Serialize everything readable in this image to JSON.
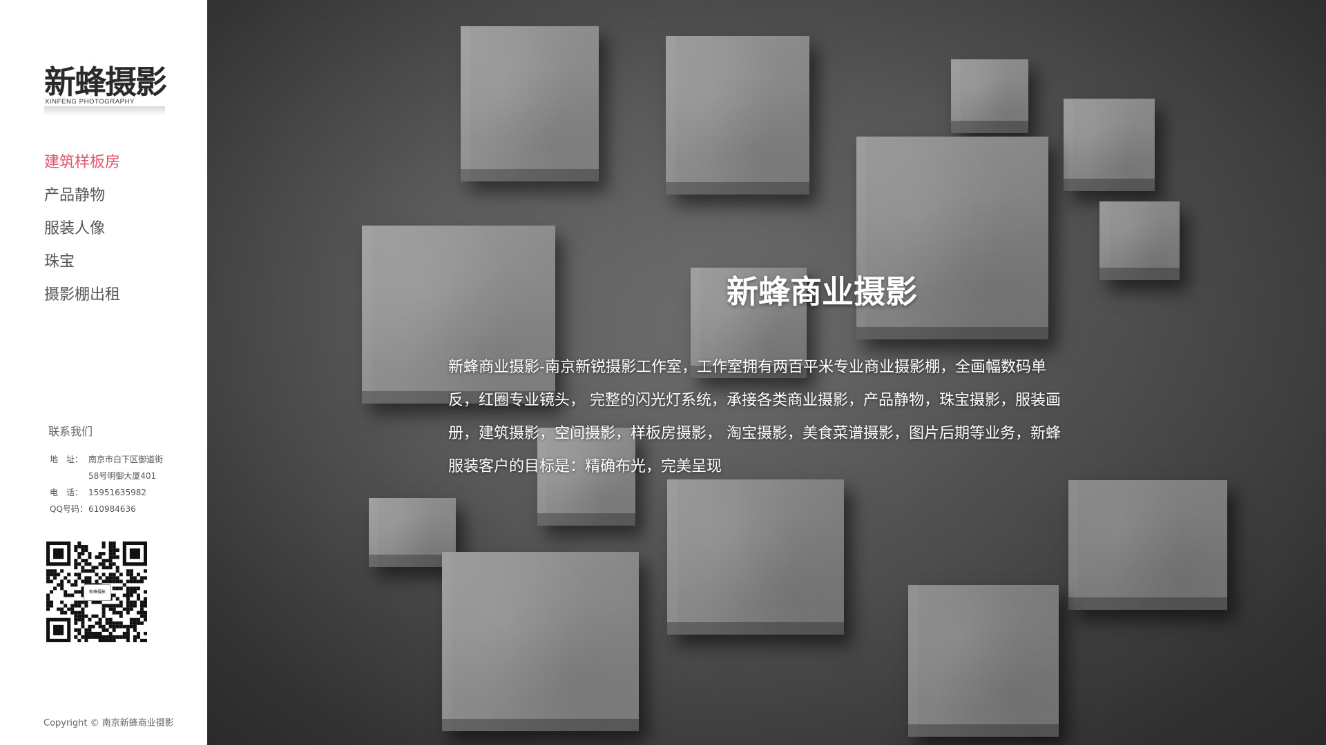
{
  "sidebar": {
    "logo": {
      "name": "新蜂摄影",
      "subtitle": "XINFENG PHOTOGRAPHY"
    },
    "nav": [
      {
        "label": "建筑样板房",
        "active": true
      },
      {
        "label": "产品静物",
        "active": false
      },
      {
        "label": "服装人像",
        "active": false
      },
      {
        "label": "珠宝",
        "active": false
      },
      {
        "label": "摄影棚出租",
        "active": false
      }
    ],
    "contact": {
      "title": "联系我们",
      "address_label": "地　址：",
      "address_line1": "南京市白下区御道街",
      "address_line2": "58号明御大厦401",
      "phone_label": "电　话：",
      "phone": "15951635982",
      "qq_label": "QQ号码：",
      "qq": "610984636"
    },
    "qr_center_text": "新蜂摄影",
    "copyright": "Copyright © 南京新蜂商业摄影"
  },
  "hero": {
    "title": "新蜂商业摄影",
    "description": "新蜂商业摄影-南京新锐摄影工作室，工作室拥有两百平米专业商业摄影棚，全画幅数码单反，红圈专业镜头， 完整的闪光灯系统，承接各类商业摄影，产品静物，珠宝摄影，服装画册，建筑摄影，空间摄影，样板房摄影， 淘宝摄影，美食菜谱摄影，图片后期等业务，新蜂服装客户的目标是：精确布光，完美呈现"
  },
  "colors": {
    "accent": "#e0566e",
    "nav_text": "#555555",
    "sidebar_bg": "#ffffff"
  }
}
